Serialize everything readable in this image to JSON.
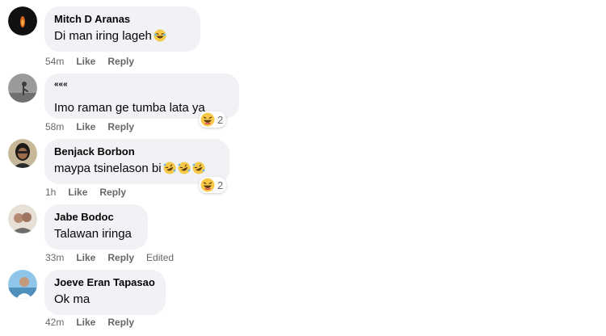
{
  "comments": [
    {
      "author": "Mitch D Aranas",
      "text": "Di man iring lageh",
      "time": "54m",
      "like": "Like",
      "reply": "Reply",
      "emoji": "laughing-emoji"
    },
    {
      "author": "«««",
      "text": "Imo raman ge tumba lata ya",
      "time": "58m",
      "like": "Like",
      "reply": "Reply",
      "reaction_count": "2",
      "reaction_icon": "haha-reaction"
    },
    {
      "author": "Benjack Borbon",
      "text": "maypa tsinelason bi",
      "time": "1h",
      "like": "Like",
      "reply": "Reply",
      "emoji": "rofl-emoji",
      "reaction_count": "2",
      "reaction_icon": "haha-reaction"
    },
    {
      "author": "Jabe Bodoc",
      "text": "Talawan iringa",
      "time": "33m",
      "like": "Like",
      "reply": "Reply",
      "edited": "Edited"
    },
    {
      "author": "Joeve Eran Tapasao",
      "text": "Ok ma",
      "time": "42m",
      "like": "Like",
      "reply": "Reply"
    }
  ],
  "colors": {
    "bubble": "#f0f2f5",
    "meta": "#65676b",
    "emoji_yellow": "#f7c948"
  }
}
